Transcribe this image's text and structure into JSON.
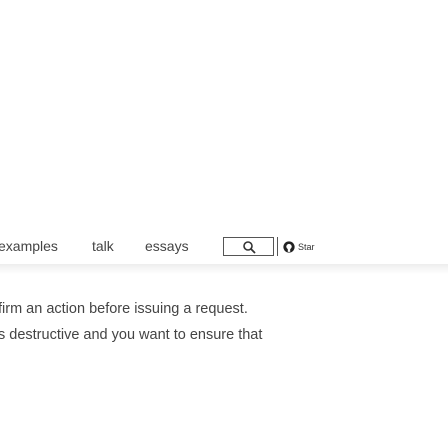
{
  "nav": {
    "links": [
      {
        "label": "examples"
      },
      {
        "label": "talk"
      },
      {
        "label": "essays"
      }
    ],
    "search": {
      "icon": "search-icon"
    },
    "star_button": {
      "icon": "github-icon",
      "label": "Star"
    }
  },
  "content": {
    "lines": [
      "firm an action before issuing a request.",
      "s destructive and you want to ensure that"
    ]
  }
}
